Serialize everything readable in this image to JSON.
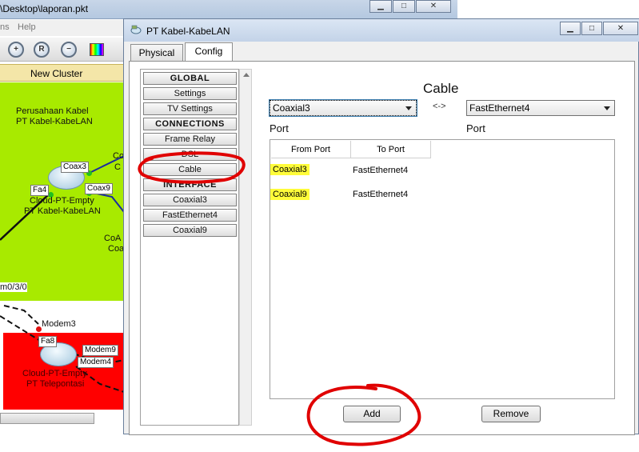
{
  "background_app": {
    "title": "\\Desktop\\laporan.pkt",
    "menu_partial": "ns",
    "menu_help": "Help",
    "toolbar_icons": [
      "zoom-in-icon",
      "zoom-reset-icon",
      "zoom-out-icon",
      "palette-icon"
    ],
    "cluster_label": "New Cluster",
    "map": {
      "company_label_1": "Perusahaan Kabel",
      "company_label_2": "PT Kabel-KabeLAN",
      "coax3": "Coax3",
      "coax9": "Coax9",
      "fa4": "Fa4",
      "cloud1_name_1": "Cloud-PT-Empty",
      "cloud1_name_2": "PT Kabel-KabeLAN",
      "co_fragment": "CoA",
      "coa_fragment": "Coa",
      "c_fragment": "C",
      "co_top": "Co",
      "mod_port": "m0/3/0",
      "modem3": "Modem3",
      "fa8": "Fa8",
      "modem9": "Modem9",
      "modem4": "Modem4",
      "cloud2_name_1": "Cloud-PT-Empty",
      "cloud2_name_2": "PT Telepontasi"
    }
  },
  "dialog": {
    "title": "PT Kabel-KabeLAN",
    "tabs": [
      {
        "label": "Physical",
        "active": false
      },
      {
        "label": "Config",
        "active": true
      }
    ],
    "sidebar": {
      "items": [
        {
          "label": "GLOBAL",
          "header": true
        },
        {
          "label": "Settings",
          "header": false
        },
        {
          "label": "TV Settings",
          "header": false
        },
        {
          "label": "CONNECTIONS",
          "header": true
        },
        {
          "label": "Frame Relay",
          "header": false
        },
        {
          "label": "DSL",
          "header": false
        },
        {
          "label": "Cable",
          "header": false
        },
        {
          "label": "INTERFACE",
          "header": true
        },
        {
          "label": "Coaxial3",
          "header": false
        },
        {
          "label": "FastEthernet4",
          "header": false
        },
        {
          "label": "Coaxial9",
          "header": false
        }
      ]
    },
    "panel": {
      "title": "Cable",
      "from_select": "Coaxial3",
      "to_select": "FastEthernet4",
      "separator": "<->",
      "port_left": "Port",
      "port_right": "Port",
      "table": {
        "headers": [
          "From Port",
          "To Port"
        ],
        "rows": [
          {
            "from": "Coaxial3",
            "to": "FastEthernet4"
          },
          {
            "from": "Coaxial9",
            "to": "FastEthernet4"
          }
        ]
      },
      "add_button": "Add",
      "remove_button": "Remove"
    }
  },
  "colors": {
    "green_zone": "#a8ea00",
    "red_zone": "#ff0000",
    "highlight": "#fffc3a",
    "annotation": "#e00000"
  }
}
